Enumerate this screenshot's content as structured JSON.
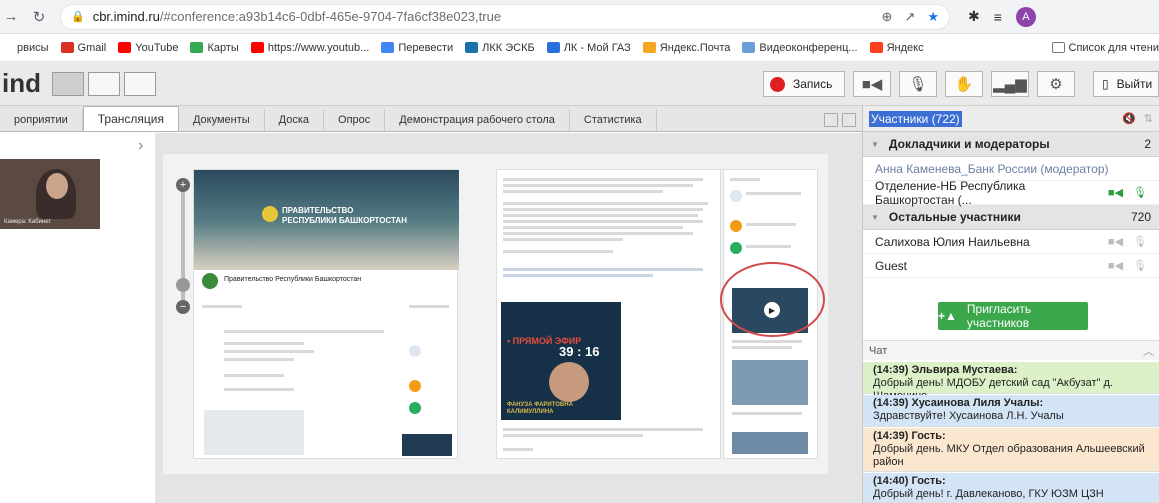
{
  "browser": {
    "url_host": "cbr.imind.ru",
    "url_path": "/#conference:a93b14c6-0dbf-465e-9704-7fa6cf38e023,true",
    "profile_initial": "A",
    "bookmarks": [
      {
        "label": "рвисы",
        "color": "transparent"
      },
      {
        "label": "Gmail",
        "color": "#d93025"
      },
      {
        "label": "YouTube",
        "color": "#ff0000"
      },
      {
        "label": "Карты",
        "color": "#34a853"
      },
      {
        "label": "https://www.youtub...",
        "color": "#ff0000"
      },
      {
        "label": "Перевести",
        "color": "#4285f4"
      },
      {
        "label": "ЛКК ЭСКБ",
        "color": "#1a73a8"
      },
      {
        "label": "ЛК - Мой ГАЗ",
        "color": "#2a6fdb"
      },
      {
        "label": "Яндекс.Почта",
        "color": "#f5a623"
      },
      {
        "label": "Видеоконференц...",
        "color": "#6a9fd8"
      },
      {
        "label": "Яндекс",
        "color": "#fc3f1d"
      }
    ],
    "reading_list": "Список для чтени"
  },
  "app": {
    "logo": "ind",
    "record_label": "Запись",
    "exit_label": "Выйти",
    "tabs": [
      "роприятии",
      "Трансляция",
      "Документы",
      "Доска",
      "Опрос",
      "Демонстрация рабочего стола",
      "Статистика"
    ]
  },
  "stage": {
    "video_caption": "Камерa: Кабинет",
    "vk_banner_line1": "ПРАВИТЕЛЬСТВО",
    "vk_banner_line2": "РЕСПУБЛИКИ БАШКОРТОСТАН",
    "vk_page_title": "Правительство Республики Башкортостан",
    "live_label": "• ПРЯМОЙ ЭФИР",
    "live_timer": "39 : 16",
    "live_name": "ФАНУЗА ФАРИТОВНА КАЛИМУЛЛИНА"
  },
  "participants": {
    "title": "Участники (722)",
    "speakers_group": "Докладчики и модераторы",
    "speakers_count": "2",
    "speakers": [
      {
        "name": "Анна Каменева_Банк России (модератор)",
        "mod": true
      },
      {
        "name": "Отделение-НБ Республика Башкортостан (...",
        "mod": false
      }
    ],
    "others_group": "Остальные участники",
    "others_count": "720",
    "others": [
      "Салихова Юлия Наильевна",
      "Guest"
    ],
    "invite_label": "Пригласить участников"
  },
  "chat": {
    "title": "Чат",
    "messages": [
      {
        "who": "(14:39) Эльвира Мустаева:",
        "text": "Добрый день! МДОБУ детский сад \"Акбузат\" д. Шамонино",
        "bg": "#ddf1c8"
      },
      {
        "who": "(14:39) Хусаинова Лиля Учалы:",
        "text": "Здравствуйте! Хусаинова Л.Н. Учалы",
        "bg": "#d3e4f6"
      },
      {
        "who": "(14:39) Гость:",
        "text": "Добрый день. МКУ Отдел образования Альшеевский район",
        "bg": "#fbe7cf"
      },
      {
        "who": "(14:40) Гость:",
        "text": "Добрый день! г. Давлеканово, ГКУ ЮЗМ ЦЗН",
        "bg": "#d3e4f6"
      }
    ]
  }
}
